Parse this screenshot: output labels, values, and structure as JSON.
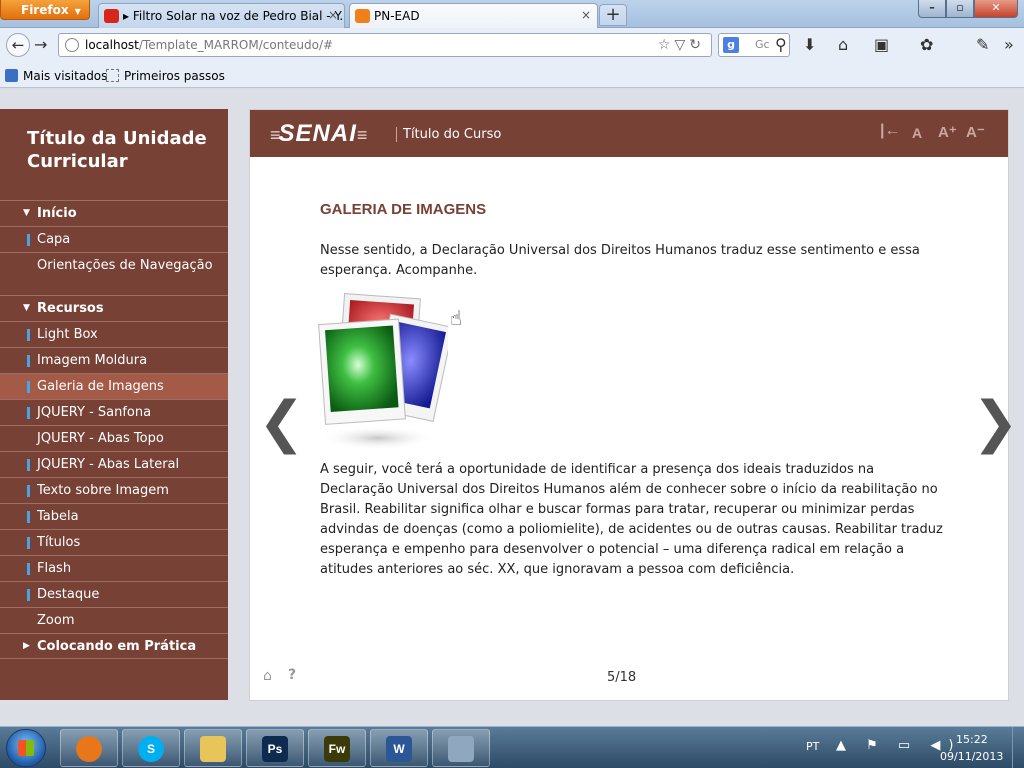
{
  "browser": {
    "firefox_label": "Firefox",
    "tabs": [
      {
        "label": "▸ Filtro Solar na voz de Pedro Bial - Y...",
        "close": "×"
      },
      {
        "label": "PN-EAD",
        "close": "×"
      }
    ],
    "new_tab": "+",
    "window_controls": {
      "minimize": "–",
      "maximize": "▫",
      "close": "✕"
    },
    "url_host": "localhost",
    "url_path": "/Template_MARROM/conteudo/#",
    "search_placeholder": "Gc",
    "search_engine_letter": "g",
    "bookmarks": [
      "Mais visitados",
      "Primeiros passos"
    ]
  },
  "sidebar": {
    "unit_title": "Título da Unidade Curricular",
    "items": [
      {
        "label": "Início",
        "type": "section",
        "expanded": true
      },
      {
        "label": "Capa",
        "type": "item",
        "marker": true
      },
      {
        "label": "Orientações de Navegação",
        "type": "item",
        "marker": false
      },
      {
        "label": "Recursos",
        "type": "section",
        "expanded": true
      },
      {
        "label": "Light Box",
        "type": "item",
        "marker": true
      },
      {
        "label": "Imagem Moldura",
        "type": "item",
        "marker": true
      },
      {
        "label": "Galeria de Imagens",
        "type": "item",
        "marker": true,
        "active": true
      },
      {
        "label": "JQUERY - Sanfona",
        "type": "item",
        "marker": true
      },
      {
        "label": "JQUERY - Abas Topo",
        "type": "item",
        "marker": false
      },
      {
        "label": "JQUERY - Abas Lateral",
        "type": "item",
        "marker": true
      },
      {
        "label": "Texto sobre Imagem",
        "type": "item",
        "marker": true
      },
      {
        "label": "Tabela",
        "type": "item",
        "marker": true
      },
      {
        "label": "Títulos",
        "type": "item",
        "marker": true
      },
      {
        "label": "Flash",
        "type": "item",
        "marker": true
      },
      {
        "label": "Destaque",
        "type": "item",
        "marker": true
      },
      {
        "label": "Zoom",
        "type": "item",
        "marker": false
      },
      {
        "label": "Colocando em Prática",
        "type": "section",
        "expanded": false
      }
    ]
  },
  "header": {
    "logo_text": "SENAI",
    "course_title": "Título do Curso",
    "tools": {
      "reset": "|←",
      "font_normal": "A",
      "font_increase": "A⁺",
      "font_decrease": "A⁻"
    }
  },
  "content": {
    "heading": "GALERIA DE IMAGENS",
    "paragraph1": "Nesse sentido, a Declaração Universal dos Direitos Humanos traduz esse sentimento e essa esperança. Acompanhe.",
    "paragraph2": "A seguir, você terá a oportunidade de identificar a presença dos ideais traduzidos na Declaração Universal dos Direitos Humanos além de conhecer sobre o início da reabilitação no Brasil. Reabilitar significa olhar e buscar formas para tratar, recuperar ou minimizar perdas advindas de doenças (como a poliomielite), de acidentes ou de outras causas. Reabilitar traduz esperança e empenho para desenvolver o potencial – uma diferença radical em relação a atitudes anteriores ao séc. XX, que ignoravam a pessoa com deficiência.",
    "prev": "❮",
    "next": "❯",
    "page_counter": "5/18",
    "home_icon": "⌂",
    "help_icon": "?"
  },
  "taskbar": {
    "apps": [
      {
        "name": "firefox",
        "label": "",
        "color": "#e8761a"
      },
      {
        "name": "skype",
        "label": "S",
        "color": "#00aff0"
      },
      {
        "name": "explorer",
        "label": "",
        "color": "#e8c55a"
      },
      {
        "name": "photoshop",
        "label": "Ps",
        "color": "#0d2b4e"
      },
      {
        "name": "fireworks",
        "label": "Fw",
        "color": "#3b3b0a"
      },
      {
        "name": "word",
        "label": "W",
        "color": "#2b5797"
      },
      {
        "name": "calculator",
        "label": "",
        "color": "#8fa8c0"
      }
    ],
    "language": "PT",
    "tray": "▲ ⚑ ▭ ◀)",
    "time": "15:22",
    "date": "09/11/2013"
  },
  "colors": {
    "brand": "#774136",
    "active_item": "#a35a46",
    "marker": "#4aa3e8"
  }
}
